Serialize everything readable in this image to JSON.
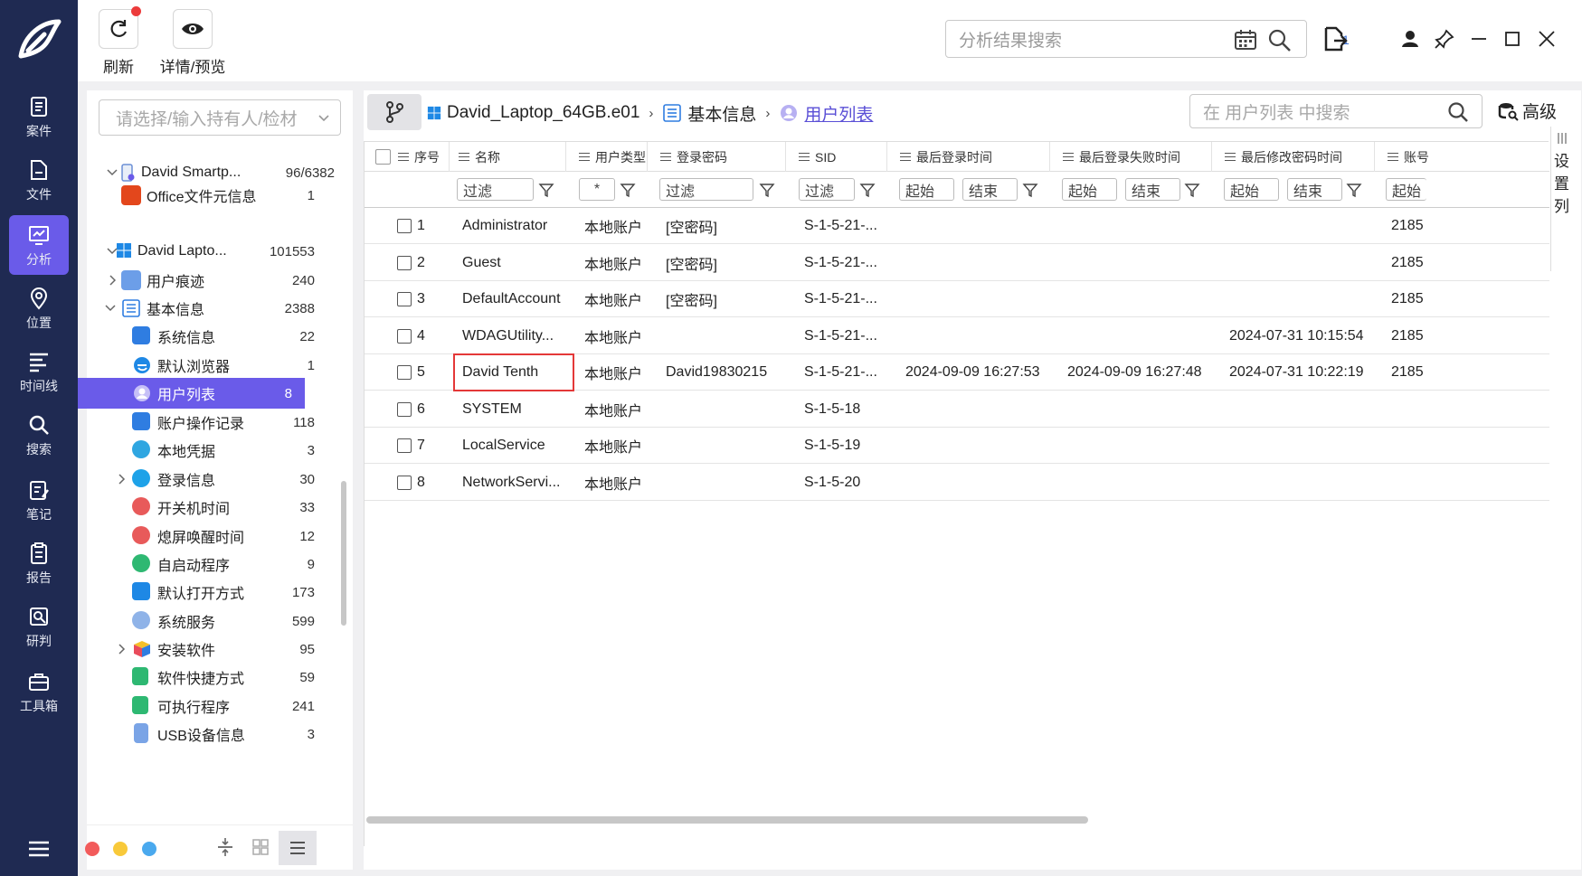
{
  "rail": {
    "items": [
      {
        "label": "案件",
        "icon": "case-icon"
      },
      {
        "label": "文件",
        "icon": "file-icon"
      },
      {
        "label": "分析",
        "icon": "analysis-icon",
        "active": true
      },
      {
        "label": "位置",
        "icon": "location-icon"
      },
      {
        "label": "时间线",
        "icon": "timeline-icon"
      },
      {
        "label": "搜索",
        "icon": "search-icon"
      },
      {
        "label": "笔记",
        "icon": "note-icon"
      },
      {
        "label": "报告",
        "icon": "report-icon"
      },
      {
        "label": "研判",
        "icon": "judge-icon"
      },
      {
        "label": "工具箱",
        "icon": "toolbox-icon"
      }
    ]
  },
  "toolbar": {
    "refresh_label": "刷新",
    "details_label": "详情/预览",
    "search_placeholder": "分析结果搜索",
    "count": "1"
  },
  "tree": {
    "holder_placeholder": "请选择/输入持有人/检材",
    "rows": [
      {
        "label": "David Smartp...",
        "count": "96/6382"
      },
      {
        "label": "Office文件元信息",
        "count": "1"
      },
      {
        "label": "David Lapto...",
        "count": "101553"
      },
      {
        "label": "用户痕迹",
        "count": "240"
      },
      {
        "label": "基本信息",
        "count": "2388"
      },
      {
        "label": "系统信息",
        "count": "22"
      },
      {
        "label": "默认浏览器",
        "count": "1"
      },
      {
        "label": "用户列表",
        "count": "8"
      },
      {
        "label": "账户操作记录",
        "count": "118"
      },
      {
        "label": "本地凭据",
        "count": "3"
      },
      {
        "label": "登录信息",
        "count": "30"
      },
      {
        "label": "开关机时间",
        "count": "33"
      },
      {
        "label": "熄屏唤醒时间",
        "count": "12"
      },
      {
        "label": "自启动程序",
        "count": "9"
      },
      {
        "label": "默认打开方式",
        "count": "173"
      },
      {
        "label": "系统服务",
        "count": "599"
      },
      {
        "label": "安装软件",
        "count": "95"
      },
      {
        "label": "软件快捷方式",
        "count": "59"
      },
      {
        "label": "可执行程序",
        "count": "241"
      },
      {
        "label": "USB设备信息",
        "count": "3"
      }
    ]
  },
  "breadcrumb": {
    "device": "David_Laptop_64GB.e01",
    "category": "基本信息",
    "current": "用户列表"
  },
  "table_search_placeholder": "在 用户列表 中搜索",
  "advanced_label": "高级",
  "side_settings": [
    "设",
    "置",
    "列"
  ],
  "table": {
    "headers": [
      "序号",
      "名称",
      "用户类型",
      "登录密码",
      "SID",
      "最后登录时间",
      "最后登录失败时间",
      "最后修改密码时间",
      "账号"
    ],
    "filters": {
      "filter": "过滤",
      "star": "*",
      "start": "起始",
      "end": "结束"
    },
    "rows": [
      {
        "no": "1",
        "name": "Administrator",
        "type": "本地账户",
        "password": "[空密码]",
        "sid": "S-1-5-21-...",
        "last_login": "",
        "last_fail": "",
        "last_pwd": "",
        "acct": "2185"
      },
      {
        "no": "2",
        "name": "Guest",
        "type": "本地账户",
        "password": "[空密码]",
        "sid": "S-1-5-21-...",
        "last_login": "",
        "last_fail": "",
        "last_pwd": "",
        "acct": "2185"
      },
      {
        "no": "3",
        "name": "DefaultAccount",
        "type": "本地账户",
        "password": "[空密码]",
        "sid": "S-1-5-21-...",
        "last_login": "",
        "last_fail": "",
        "last_pwd": "",
        "acct": "2185"
      },
      {
        "no": "4",
        "name": "WDAGUtility...",
        "type": "本地账户",
        "password": "",
        "sid": "S-1-5-21-...",
        "last_login": "",
        "last_fail": "",
        "last_pwd": "2024-07-31 10:15:54",
        "acct": "2185"
      },
      {
        "no": "5",
        "name": "David Tenth",
        "type": "本地账户",
        "password": "David19830215",
        "sid": "S-1-5-21-...",
        "last_login": "2024-09-09 16:27:53",
        "last_fail": "2024-09-09 16:27:48",
        "last_pwd": "2024-07-31 10:22:19",
        "acct": "2185"
      },
      {
        "no": "6",
        "name": "SYSTEM",
        "type": "本地账户",
        "password": "",
        "sid": "S-1-5-18",
        "last_login": "",
        "last_fail": "",
        "last_pwd": "",
        "acct": ""
      },
      {
        "no": "7",
        "name": "LocalService",
        "type": "本地账户",
        "password": "",
        "sid": "S-1-5-19",
        "last_login": "",
        "last_fail": "",
        "last_pwd": "",
        "acct": ""
      },
      {
        "no": "8",
        "name": "NetworkServi...",
        "type": "本地账户",
        "password": "",
        "sid": "S-1-5-20",
        "last_login": "",
        "last_fail": "",
        "last_pwd": "",
        "acct": ""
      }
    ]
  },
  "colors": {
    "rail": "#1f2a52",
    "accent": "#6a5be9",
    "highlight": "#e43838"
  }
}
